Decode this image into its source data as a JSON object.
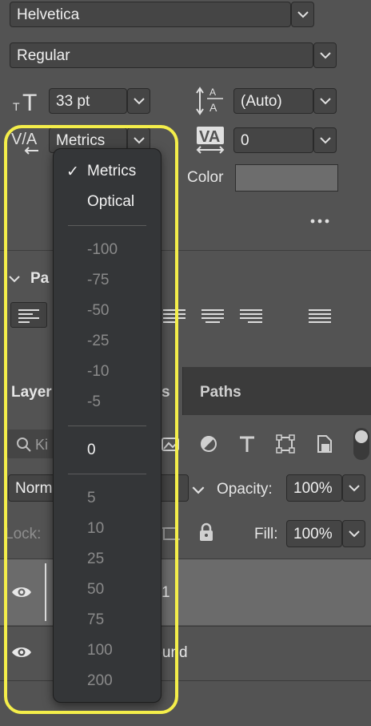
{
  "character": {
    "font_family": "Helvetica",
    "font_style": "Regular",
    "font_size": "33 pt",
    "leading": "(Auto)",
    "kerning": "Metrics",
    "tracking": "0",
    "color_label": "Color",
    "color_value": "#6d6d6d",
    "more_icon": "ellipsis-icon"
  },
  "paragraph": {
    "header_partial": "Pa"
  },
  "layers_panel": {
    "tabs": [
      "Layer",
      "s",
      "Paths"
    ],
    "filter_placeholder": "Ki",
    "blend_mode": "Norm",
    "opacity_label": "Opacity:",
    "opacity_value": "100%",
    "lock_label": "Lock:",
    "fill_label": "Fill:",
    "fill_value": "100%",
    "layers": [
      {
        "name_partial": "1",
        "visible": true
      },
      {
        "name_partial": "round",
        "visible": true
      }
    ]
  },
  "kerning_menu": {
    "items": [
      {
        "label": "Metrics",
        "checked": true,
        "enabled": true
      },
      {
        "label": "Optical",
        "checked": false,
        "enabled": true
      },
      {
        "separator": true
      },
      {
        "label": "-100",
        "enabled": false
      },
      {
        "label": "-75",
        "enabled": false
      },
      {
        "label": "-50",
        "enabled": false
      },
      {
        "label": "-25",
        "enabled": false
      },
      {
        "label": "-10",
        "enabled": false
      },
      {
        "label": "-5",
        "enabled": false
      },
      {
        "separator": true
      },
      {
        "label": "0",
        "enabled": true
      },
      {
        "separator": true
      },
      {
        "label": "5",
        "enabled": false
      },
      {
        "label": "10",
        "enabled": false
      },
      {
        "label": "25",
        "enabled": false
      },
      {
        "label": "50",
        "enabled": false
      },
      {
        "label": "75",
        "enabled": false
      },
      {
        "label": "100",
        "enabled": false
      },
      {
        "label": "200",
        "enabled": false
      }
    ],
    "checkmark": "✓"
  },
  "highlight_color": "#f4ee4a"
}
